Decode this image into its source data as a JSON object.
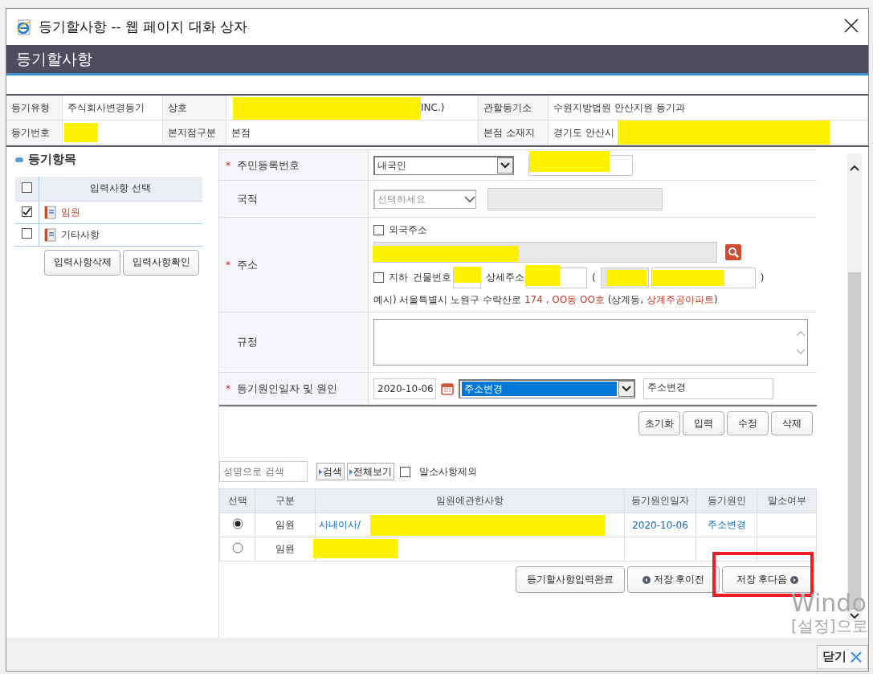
{
  "window": {
    "title": "등기할사항 -- 웹 페이지 대화 상자"
  },
  "header": {
    "title": "등기할사항"
  },
  "info": [
    [
      {
        "label": "등기유형",
        "value": "주식회사변경등기"
      },
      {
        "label": "상호",
        "value": "INC.)"
      },
      {
        "label": "관할등기소",
        "value": "수원지방법원 안산지원 등기과"
      }
    ],
    [
      {
        "label": "등기번호"
      },
      {
        "label": "본지점구분",
        "value": "본점"
      },
      {
        "label": "본점 소재지",
        "value": "경기도 안산시"
      }
    ]
  ],
  "items_panel": {
    "title": "등기항목",
    "header": "입력사항 선택",
    "all_checked": false,
    "items": [
      {
        "label": "임원",
        "checked": true,
        "selected": true
      },
      {
        "label": "기타사항",
        "checked": false,
        "selected": false
      }
    ],
    "buttons": [
      "입력사항삭제",
      "입력사항확인"
    ]
  },
  "form": {
    "rows": [
      {
        "kind": "resident",
        "label": "주민등록번호",
        "required_mark": "*",
        "select": "내국인"
      },
      {
        "kind": "nationality",
        "label": "국적",
        "placeholder": "선택하세요"
      },
      {
        "kind": "address",
        "label": "주소",
        "required_mark": "*",
        "foreign_label": "외국주소",
        "foreign_checked": false,
        "basement_label": "지하",
        "basement_checked": false,
        "building_label": "건물번호",
        "detail_label": "상세주소",
        "open_paren": "(",
        "close_paren": ")",
        "example": [
          {
            "text": "예시) 서울특별시 노원구 수락산로 ",
            "highlight": false
          },
          {
            "text": "174 , OO동 OO호",
            "highlight": true
          },
          {
            "text": " (상계동, ",
            "highlight": false
          },
          {
            "text": "상계주공아파트",
            "highlight": true
          },
          {
            "text": ")",
            "highlight": false
          }
        ]
      },
      {
        "kind": "textarea",
        "label": "규정"
      },
      {
        "kind": "cause",
        "label": "등기원인일자 및 원인",
        "required_mark": "*",
        "date": "2020-10-06",
        "cause_select": "주소변경",
        "cause_text": "주소변경"
      }
    ],
    "buttons": [
      "초기화",
      "입력",
      "수정",
      "삭제"
    ]
  },
  "search": {
    "placeholder": "성명으로 검색",
    "buttons": [
      "검색",
      "전체보기"
    ],
    "exclude_label": "말소사항제외",
    "exclude_checked": false
  },
  "table": {
    "columns": [
      "선택",
      "구분",
      "임원에관한사항",
      "등기원인일자",
      "등기원인",
      "말소여부"
    ],
    "rows": [
      {
        "selected": true,
        "type": "임원",
        "detail": "사내이사/",
        "date": "2020-10-06",
        "cause": "주소변경"
      },
      {
        "selected": false,
        "type": "임원"
      }
    ]
  },
  "nav_buttons": [
    {
      "kind": "plain",
      "label": "등기할사항입력완료"
    },
    {
      "kind": "prev",
      "label": "저장 후이전"
    },
    {
      "kind": "next",
      "label": "저장 후다음",
      "highlighted": true
    }
  ],
  "close_button": "닫기",
  "os_notice": [
    "Windo",
    "[설정]으로"
  ]
}
